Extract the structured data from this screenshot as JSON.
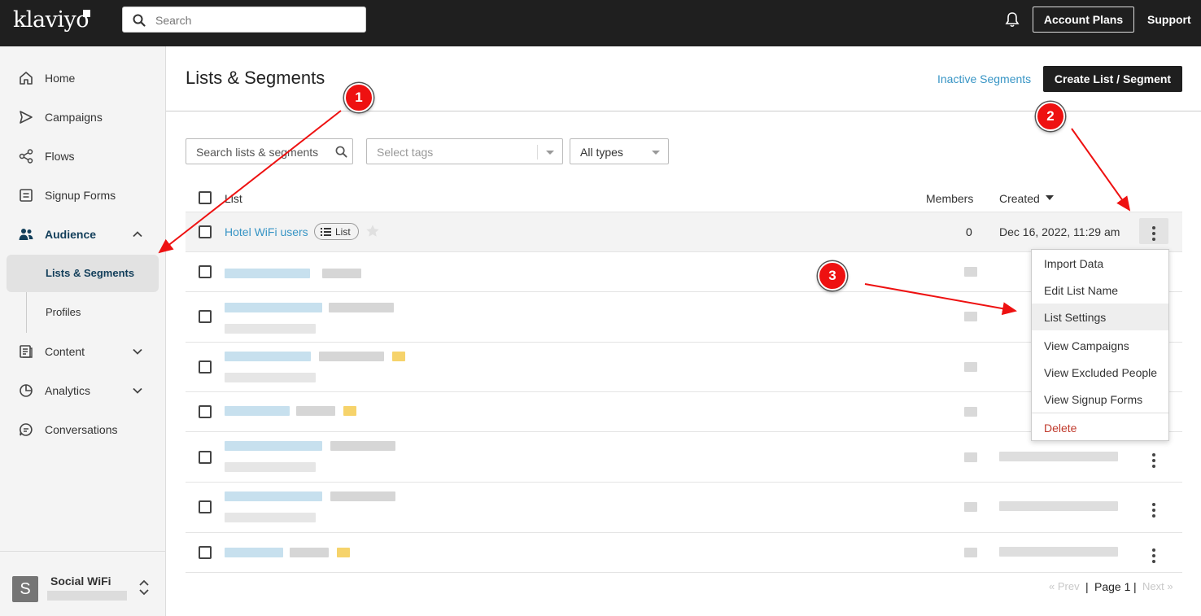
{
  "app": {
    "logo": "klaviyo",
    "search_placeholder": "Search",
    "account_plans_label": "Account Plans",
    "support_label": "Support"
  },
  "sidebar": {
    "items": [
      {
        "label": "Home",
        "icon": "home-icon"
      },
      {
        "label": "Campaigns",
        "icon": "send-icon"
      },
      {
        "label": "Flows",
        "icon": "flows-icon"
      },
      {
        "label": "Signup Forms",
        "icon": "form-icon"
      },
      {
        "label": "Audience",
        "icon": "people-icon",
        "expanded": true
      },
      {
        "label": "Content",
        "icon": "content-icon"
      },
      {
        "label": "Analytics",
        "icon": "chart-icon"
      },
      {
        "label": "Conversations",
        "icon": "chat-icon"
      }
    ],
    "subitems": [
      {
        "label": "Lists & Segments",
        "selected": true
      },
      {
        "label": "Profiles"
      }
    ],
    "account": {
      "initial": "S",
      "name": "Social WiFi"
    }
  },
  "main": {
    "title": "Lists & Segments",
    "inactive_link": "Inactive Segments",
    "create_button": "Create List / Segment",
    "filters": {
      "search_placeholder": "Search lists & segments",
      "tags_placeholder": "Select tags",
      "type_value": "All types"
    },
    "table": {
      "headers": {
        "list": "List",
        "members": "Members",
        "created": "Created"
      },
      "first_row": {
        "name": "Hotel WiFi users",
        "tag": "List",
        "members": "0",
        "created": "Dec 16, 2022, 11:29 am"
      }
    },
    "row_menu": {
      "items": [
        "Import Data",
        "Edit List Name",
        "List Settings",
        "View Campaigns",
        "View Excluded People",
        "View Signup Forms",
        "Delete"
      ],
      "highlighted": "List Settings"
    },
    "pagination": {
      "prev": "« Prev",
      "sep": "|",
      "page": "Page 1",
      "next": "Next »"
    }
  },
  "annotations": [
    "1",
    "2",
    "3"
  ],
  "colors": {
    "accent": "#3895c5",
    "annotation": "#ee1111",
    "topbar": "#1f1f1f",
    "danger": "#c0392b"
  }
}
